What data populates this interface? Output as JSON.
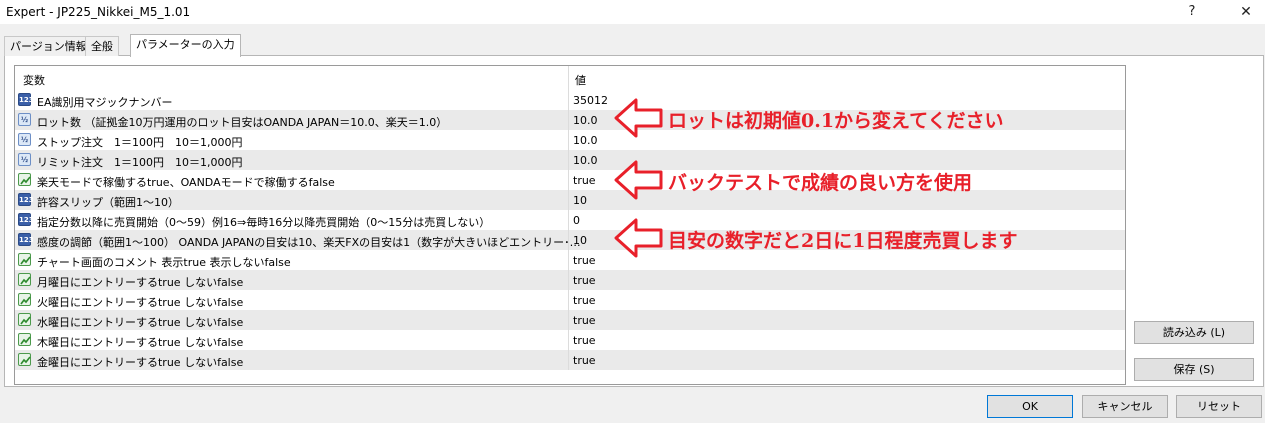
{
  "window": {
    "title": "Expert - JP225_Nikkei_M5_1.01",
    "help_label": "?",
    "close_label": "✕"
  },
  "tabs": [
    {
      "label": "パージョン情報"
    },
    {
      "label": "全般"
    },
    {
      "label": "パラメーターの入力"
    }
  ],
  "grid": {
    "col_variable": "変数",
    "col_value": "値",
    "rows": [
      {
        "type": "int",
        "name": "EA識別用マジックナンバー",
        "value": "35012"
      },
      {
        "type": "dbl",
        "name": "ロット数 （証拠金10万円運用のロット目安はOANDA JAPAN＝10.0、楽天＝1.0）",
        "value": "10.0"
      },
      {
        "type": "dbl",
        "name": "ストップ注文　1＝100円　10＝1,000円",
        "value": "10.0"
      },
      {
        "type": "dbl",
        "name": "リミット注文　1＝100円　10＝1,000円",
        "value": "10.0"
      },
      {
        "type": "bool",
        "name": "楽天モードで稼働するtrue、OANDAモードで稼働するfalse",
        "value": "true"
      },
      {
        "type": "int",
        "name": "許容スリップ（範囲1〜10）",
        "value": "10"
      },
      {
        "type": "int",
        "name": "指定分数以降に売買開始（0〜59）例16⇒毎時16分以降売買開始（0〜15分は売買しない）",
        "value": "0"
      },
      {
        "type": "int",
        "name": "感度の調節（範囲1〜100） OANDA JAPANの目安は10、楽天FXの目安は1（数字が大きいほどエントリー･…",
        "value": "10"
      },
      {
        "type": "bool",
        "name": "チャート画面のコメント 表示true 表示しないfalse",
        "value": "true"
      },
      {
        "type": "bool",
        "name": "月曜日にエントリーするtrue しないfalse",
        "value": "true"
      },
      {
        "type": "bool",
        "name": "火曜日にエントリーするtrue しないfalse",
        "value": "true"
      },
      {
        "type": "bool",
        "name": "水曜日にエントリーするtrue しないfalse",
        "value": "true"
      },
      {
        "type": "bool",
        "name": "木曜日にエントリーするtrue しないfalse",
        "value": "true"
      },
      {
        "type": "bool",
        "name": "金曜日にエントリーするtrue しないfalse",
        "value": "true"
      }
    ]
  },
  "icon_text": {
    "int": "123",
    "dbl": "½"
  },
  "side_buttons": {
    "load_label": "読み込み (L)",
    "save_label": "保存 (S)"
  },
  "footer": {
    "ok_label": "OK",
    "cancel_label": "キャンセル",
    "reset_label": "リセット"
  },
  "annotations": [
    {
      "text": "ロットは初期値0.1から変えてください"
    },
    {
      "text": "バックテストで成績の良い方を使用"
    },
    {
      "text": "目安の数字だと2日に1日程度売買します"
    }
  ],
  "colors": {
    "annotation": "#e8202a",
    "alt_row": "#eaeaea",
    "ok_border": "#0078d7"
  }
}
